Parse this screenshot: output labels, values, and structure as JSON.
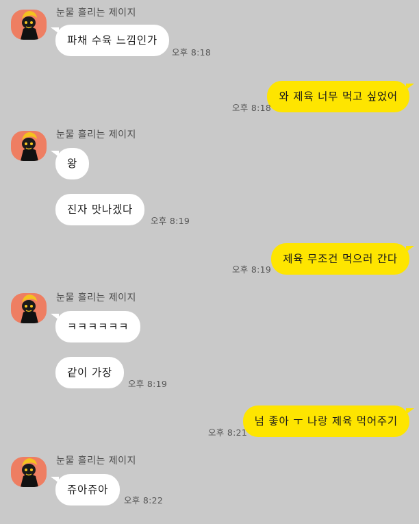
{
  "chat": {
    "colors": {
      "background": "#c9c9c9",
      "incoming_bubble": "#ffffff",
      "outgoing_bubble": "#fee500",
      "avatar_bg": "#ee7e62"
    },
    "sender_name": "눈물 흘리는 제이지",
    "messages": [
      {
        "direction": "in",
        "text": "파채 수육 느낌인가",
        "time": "오후 8:18"
      },
      {
        "direction": "out",
        "text": "와 제육 너무 먹고 싶었어",
        "time": "오후 8:18"
      },
      {
        "direction": "in",
        "text": "왕",
        "time": ""
      },
      {
        "direction": "in",
        "text": "진자 맛나겠다",
        "time": "오후 8:19"
      },
      {
        "direction": "out",
        "text": "제육 무조건 먹으러 간다",
        "time": "오후 8:19"
      },
      {
        "direction": "in",
        "text": "ㅋㅋㅋㅋㅋㅋ",
        "time": ""
      },
      {
        "direction": "in",
        "text": "같이 가장",
        "time": "오후 8:19"
      },
      {
        "direction": "out",
        "text": "넘 좋아 ㅜ 나랑 제육 먹어주기",
        "time": "오후 8:21"
      },
      {
        "direction": "in",
        "text": "쥬아쥬아",
        "time": "오후 8:22"
      }
    ]
  }
}
